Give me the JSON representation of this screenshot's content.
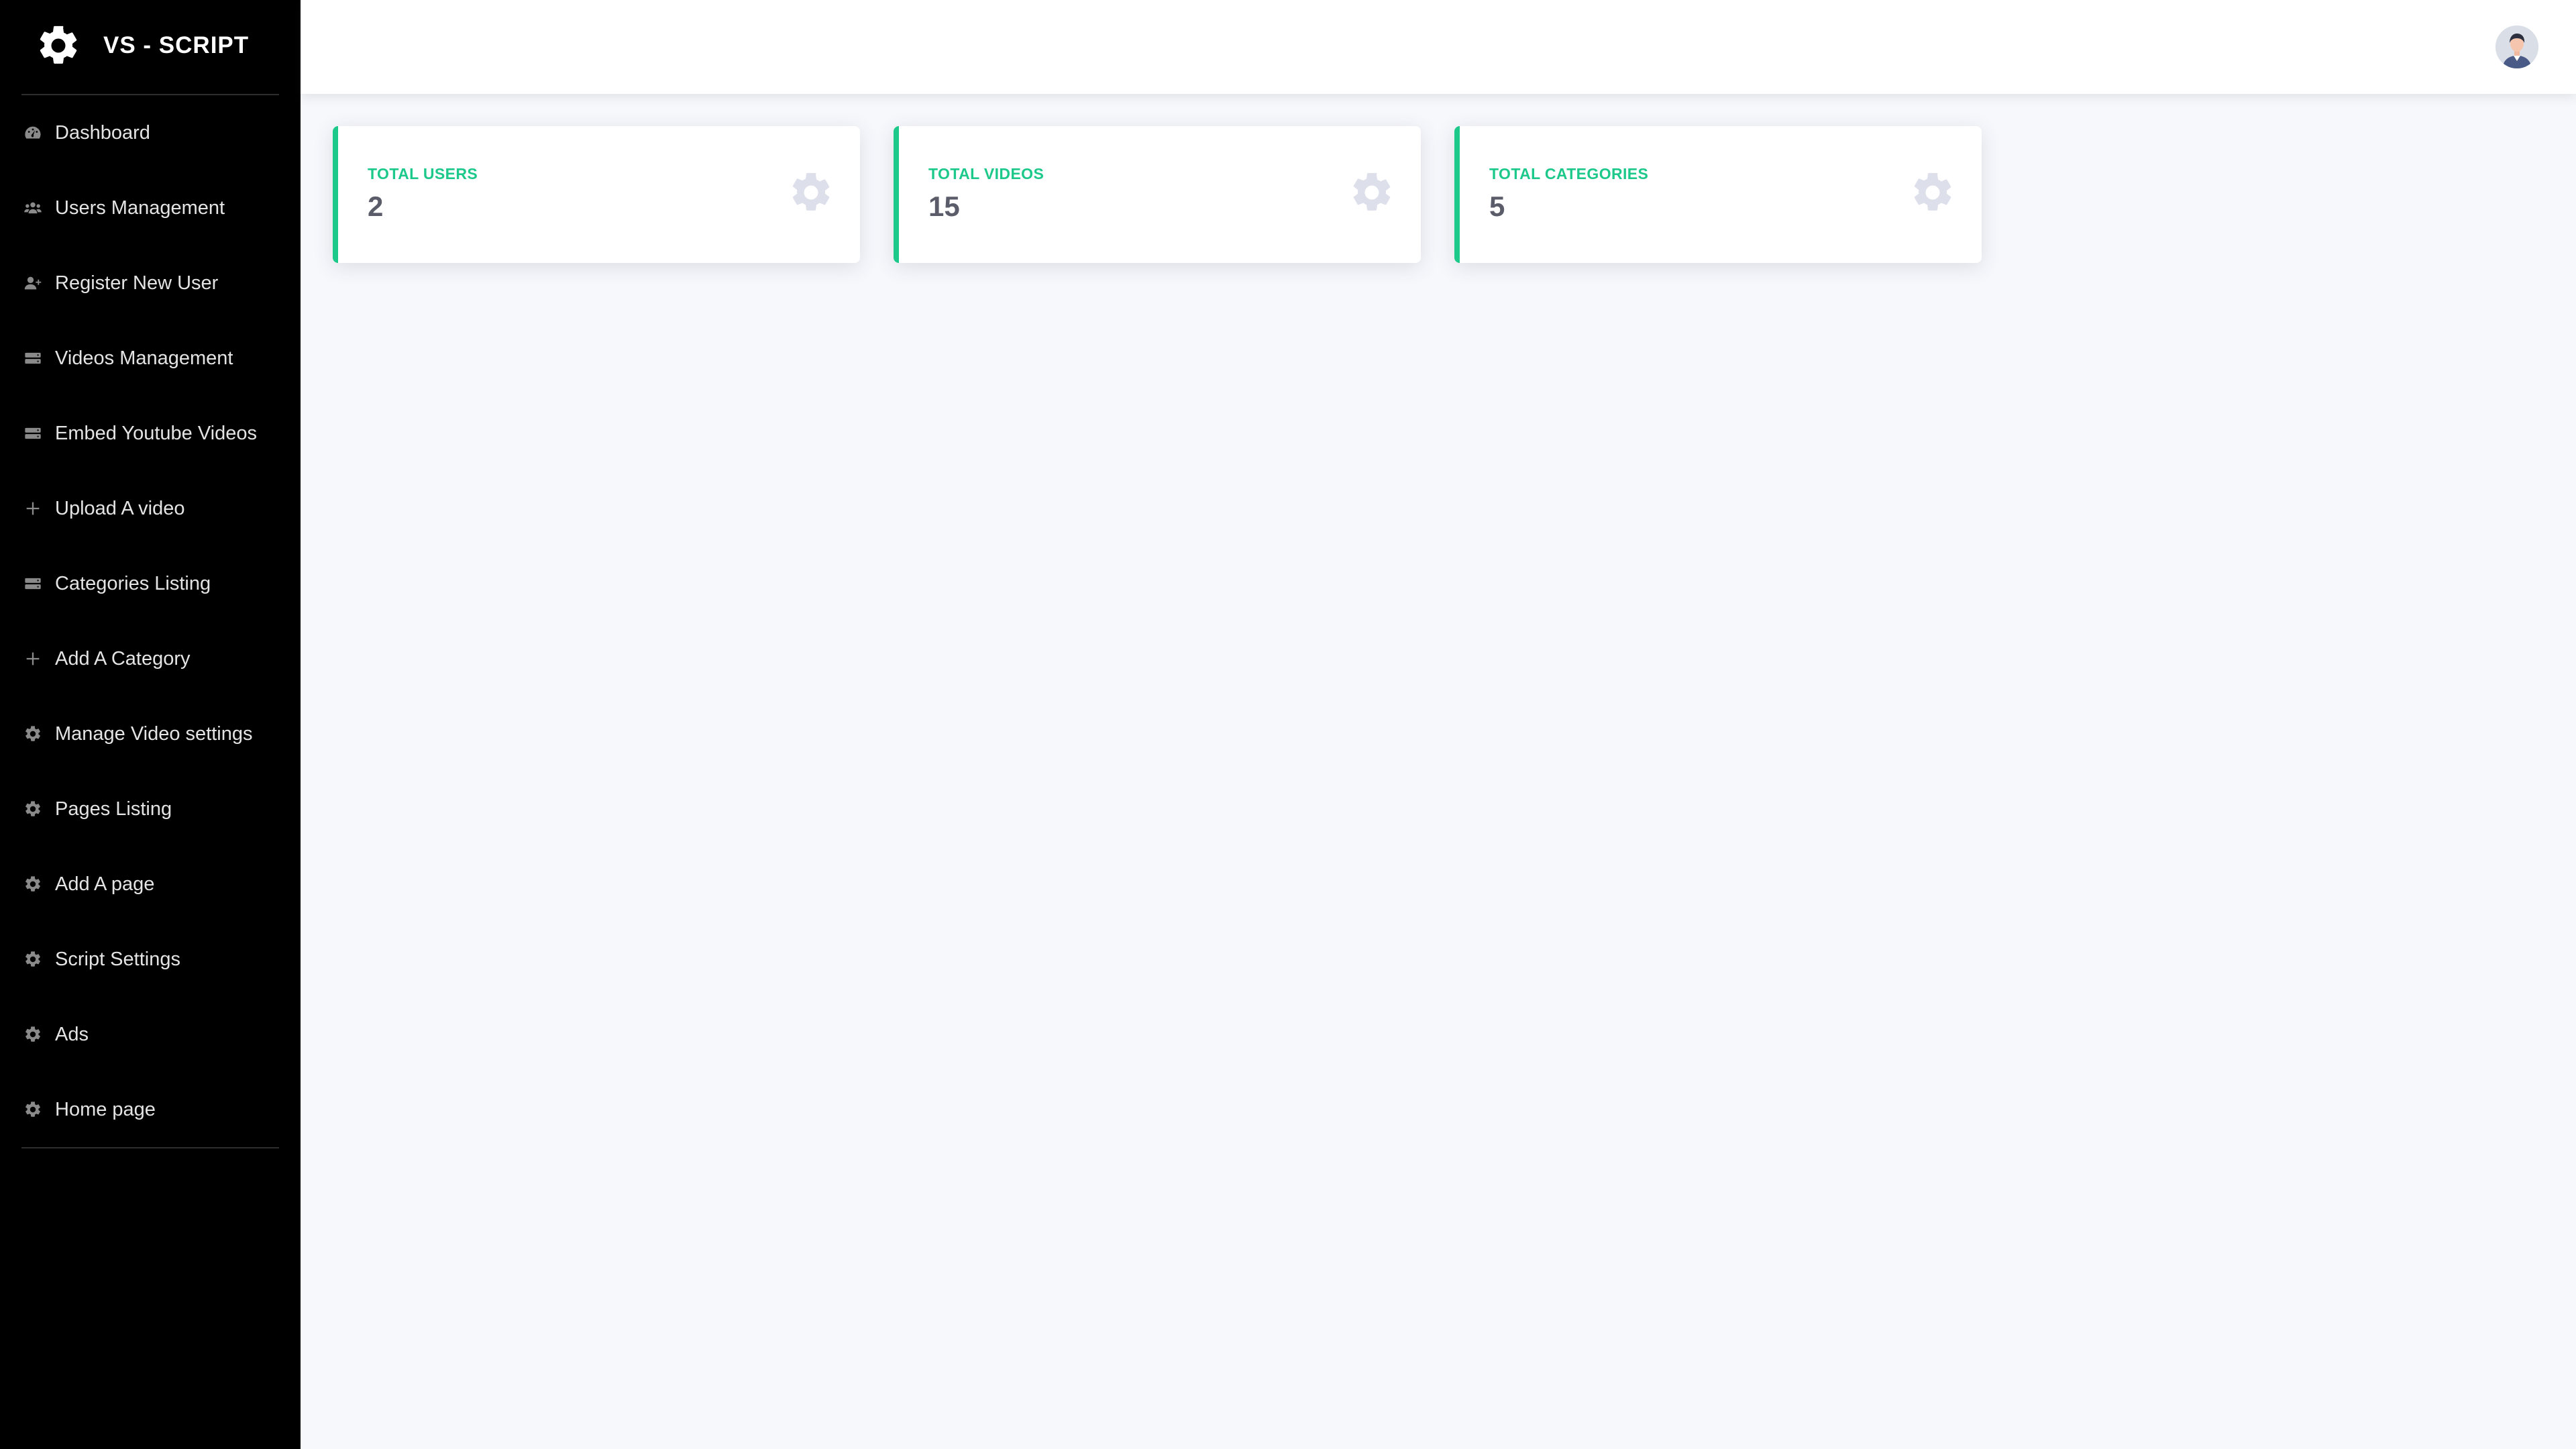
{
  "brand": {
    "title": "VS - SCRIPT",
    "icon": "gear-icon"
  },
  "sidebar": {
    "items": [
      {
        "label": "Dashboard",
        "icon": "tachometer-icon"
      },
      {
        "label": "Users Management",
        "icon": "users-icon"
      },
      {
        "label": "Register New User",
        "icon": "user-plus-icon"
      },
      {
        "label": "Videos Management",
        "icon": "server-icon"
      },
      {
        "label": "Embed Youtube Videos",
        "icon": "server-icon"
      },
      {
        "label": "Upload A video",
        "icon": "plus-icon"
      },
      {
        "label": "Categories Listing",
        "icon": "server-icon"
      },
      {
        "label": "Add A Category",
        "icon": "plus-icon"
      },
      {
        "label": "Manage Video settings",
        "icon": "gear-icon"
      },
      {
        "label": "Pages Listing",
        "icon": "gear-icon"
      },
      {
        "label": "Add A page",
        "icon": "gear-icon"
      },
      {
        "label": "Script Settings",
        "icon": "gear-icon"
      },
      {
        "label": "Ads",
        "icon": "gear-icon"
      },
      {
        "label": "Home page",
        "icon": "gear-icon"
      }
    ]
  },
  "topbar": {
    "avatar_icon": "user-avatar-icon"
  },
  "cards": [
    {
      "label": "TOTAL USERS",
      "value": "2",
      "icon": "gear-icon"
    },
    {
      "label": "TOTAL VIDEOS",
      "value": "15",
      "icon": "gear-icon"
    },
    {
      "label": "TOTAL CATEGORIES",
      "value": "5",
      "icon": "gear-icon"
    }
  ],
  "colors": {
    "sidebar_bg": "#000000",
    "accent": "#1cc88a",
    "page_bg": "#f7f8fc",
    "value_text": "#5a5c69",
    "card_icon": "#dddfeb"
  }
}
